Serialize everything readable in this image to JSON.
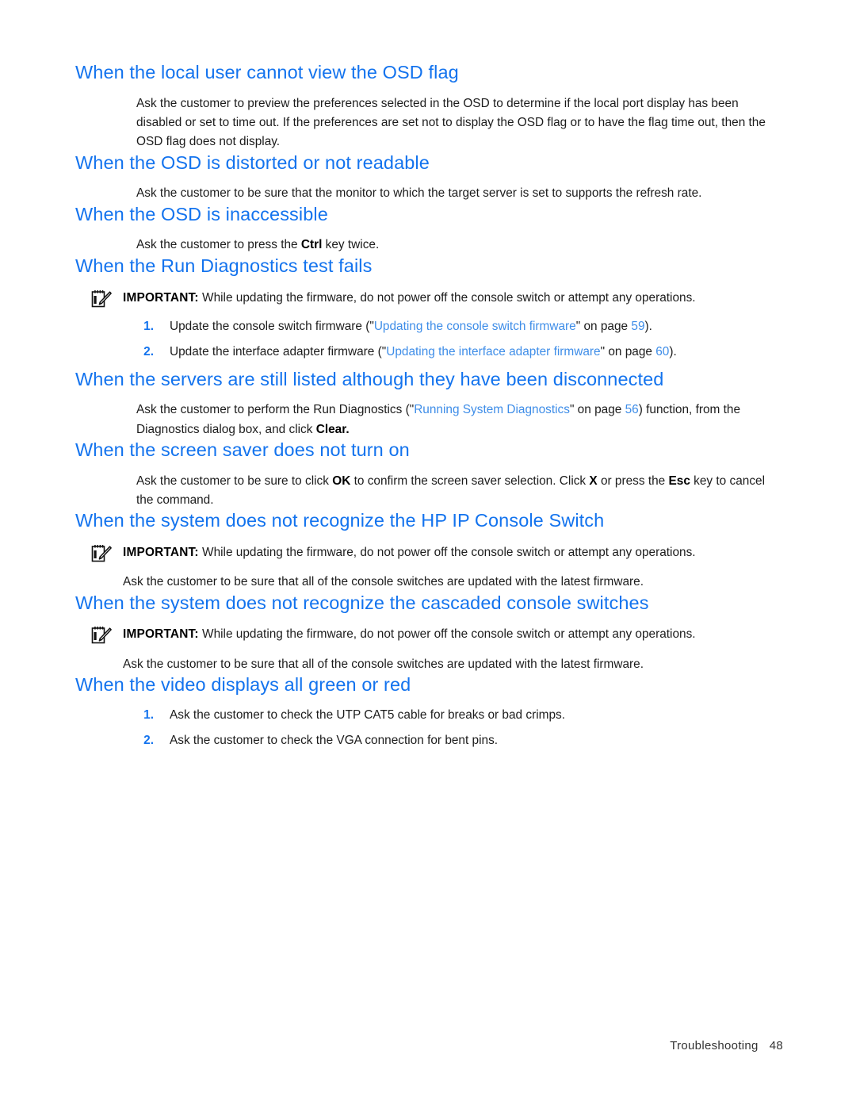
{
  "document": {
    "footer_label": "Troubleshooting",
    "footer_page": "48"
  },
  "colors": {
    "heading_blue": "#1373EE",
    "link_blue": "#3E8DE8",
    "body_text": "#1c1c1c"
  },
  "note_label": "IMPORTANT:",
  "note_icon_name": "important-note-icon",
  "sections": {
    "s1": {
      "heading": "When the local user cannot view the OSD flag",
      "body": "Ask the customer to preview the preferences selected in the OSD to determine if the local port display has been disabled or set to time out. If the preferences are set not to display the OSD flag or to have the flag time out, then the OSD flag does not display."
    },
    "s2": {
      "heading": "When the OSD is distorted or not readable",
      "body": "Ask the customer to be sure that the monitor to which the target server is set to supports the refresh rate."
    },
    "s3": {
      "heading": "When the OSD is inaccessible",
      "body_part1": "Ask the customer to press the ",
      "body_bold": "Ctrl",
      "body_part2": " key twice."
    },
    "s4": {
      "heading": "When the Run Diagnostics test fails",
      "note_text": "While updating the firmware, do not power off the console switch or attempt any operations.",
      "items": [
        {
          "num": "1.",
          "pre": "Update the console switch firmware (\"",
          "link": "Updating the console switch firmware",
          "mid": "\" on page ",
          "page": "59",
          "post": ")."
        },
        {
          "num": "2.",
          "pre": "Update the interface adapter firmware (\"",
          "link": "Updating the interface adapter firmware",
          "mid": "\" on page ",
          "page": "60",
          "post": ")."
        }
      ]
    },
    "s5": {
      "heading": "When the servers are still listed although they have been disconnected",
      "body_pre": "Ask the customer to perform the Run Diagnostics (\"",
      "body_link": "Running System Diagnostics",
      "body_mid": "\" on page ",
      "body_page": "56",
      "body_post": ") function, from the Diagnostics dialog box, and click ",
      "body_bold": "Clear."
    },
    "s6": {
      "heading": "When the screen saver does not turn on",
      "body_p1": "Ask the customer to be sure to click ",
      "body_b1": "OK",
      "body_p2": " to confirm the screen saver selection. Click ",
      "body_b2": "X",
      "body_p3": " or press the ",
      "body_b3": "Esc",
      "body_p4": " key to cancel the command."
    },
    "s7": {
      "heading": "When the system does not recognize the HP IP Console Switch",
      "note_text": "While updating the firmware, do not power off the console switch or attempt any operations.",
      "body": "Ask the customer to be sure that all of the console switches are updated with the latest firmware."
    },
    "s8": {
      "heading": "When the system does not recognize the cascaded console switches",
      "note_text": "While updating the firmware, do not power off the console switch or attempt any operations.",
      "body": "Ask the customer to be sure that all of the console switches are updated with the latest firmware."
    },
    "s9": {
      "heading": "When the video displays all green or red",
      "items": [
        {
          "num": "1.",
          "text": "Ask the customer to check the UTP CAT5 cable for breaks or bad crimps."
        },
        {
          "num": "2.",
          "text": "Ask the customer to check the VGA connection for bent pins."
        }
      ]
    }
  }
}
